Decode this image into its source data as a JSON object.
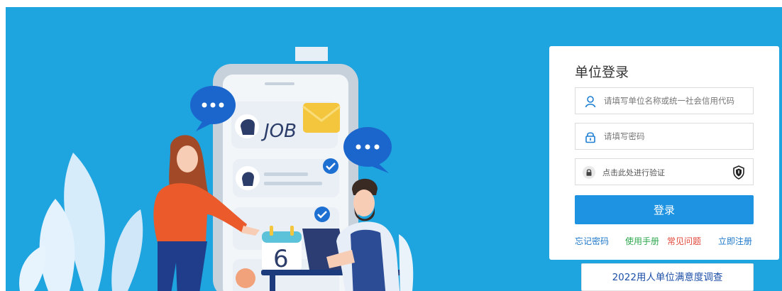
{
  "illustration": {
    "job_text": "JOB",
    "calendar_day": "6"
  },
  "login": {
    "title": "单位登录",
    "username_placeholder": "请填写单位名称或统一社会信用代码",
    "password_placeholder": "请填写密码",
    "verify_text": "点击此处进行验证",
    "submit_label": "登录"
  },
  "links": {
    "forgot_password": "忘记密码",
    "user_manual": "使用手册",
    "faq": "常见问题",
    "register": "立即注册"
  },
  "survey": {
    "label": "2022用人单位满意度调查"
  },
  "colors": {
    "hero_background": "#1ea4df",
    "primary_button": "#1d93e2",
    "forgot_link": "#1d78c9",
    "manual_link": "#2fa84f",
    "faq_link": "#e0483a",
    "register_link": "#1d78c9",
    "survey_text": "#1e4fa8"
  },
  "icons": {
    "username": "user-icon",
    "password": "padlock-icon",
    "verify": "lock-icon",
    "verify_badge": "shield-icon"
  }
}
